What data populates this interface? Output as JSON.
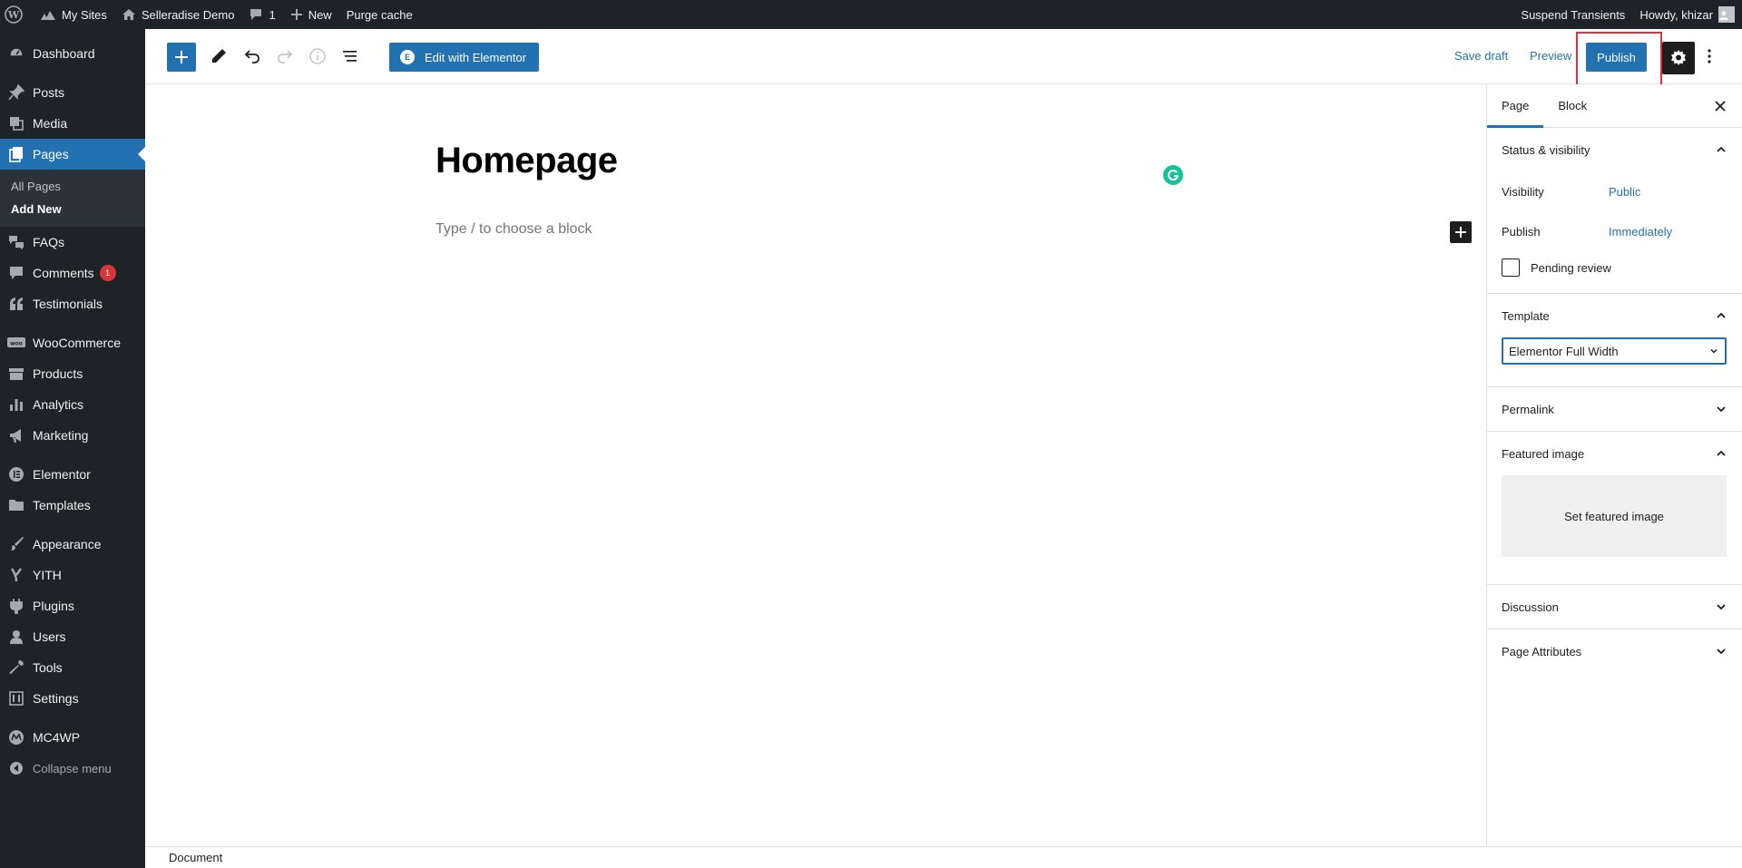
{
  "adminbar": {
    "my_sites": "My Sites",
    "site_name": "Selleradise Demo",
    "comments_count": "1",
    "new_label": "New",
    "purge_cache": "Purge cache",
    "suspend_transients": "Suspend Transients",
    "howdy": "Howdy, khizar"
  },
  "sidebar": {
    "items": [
      {
        "label": "Dashboard",
        "icon": "dashboard-icon"
      },
      {
        "label": "Posts",
        "icon": "pin-icon"
      },
      {
        "label": "Media",
        "icon": "media-icon"
      },
      {
        "label": "Pages",
        "icon": "pages-icon"
      },
      {
        "label": "FAQs",
        "icon": "faq-icon"
      },
      {
        "label": "Comments",
        "icon": "comment-icon",
        "badge": "1"
      },
      {
        "label": "Testimonials",
        "icon": "quote-icon"
      },
      {
        "label": "WooCommerce",
        "icon": "woo-icon"
      },
      {
        "label": "Products",
        "icon": "archive-icon"
      },
      {
        "label": "Analytics",
        "icon": "chart-icon"
      },
      {
        "label": "Marketing",
        "icon": "megaphone-icon"
      },
      {
        "label": "Elementor",
        "icon": "elementor-icon"
      },
      {
        "label": "Templates",
        "icon": "folder-icon"
      },
      {
        "label": "Appearance",
        "icon": "brush-icon"
      },
      {
        "label": "YITH",
        "icon": "yith-icon"
      },
      {
        "label": "Plugins",
        "icon": "plug-icon"
      },
      {
        "label": "Users",
        "icon": "user-icon"
      },
      {
        "label": "Tools",
        "icon": "wrench-icon"
      },
      {
        "label": "Settings",
        "icon": "settings-icon"
      },
      {
        "label": "MC4WP",
        "icon": "mc4wp-icon"
      }
    ],
    "submenu": [
      "All Pages",
      "Add New"
    ],
    "collapse": "Collapse menu"
  },
  "header": {
    "edit_elementor": "Edit with Elementor",
    "save_draft": "Save draft",
    "preview": "Preview",
    "publish": "Publish"
  },
  "editor": {
    "title": "Homepage",
    "placeholder": "Type / to choose a block"
  },
  "panel": {
    "tabs": [
      "Page",
      "Block"
    ],
    "status_visibility": "Status & visibility",
    "visibility_label": "Visibility",
    "visibility_value": "Public",
    "publish_label": "Publish",
    "publish_value": "Immediately",
    "pending_review": "Pending review",
    "template_label": "Template",
    "template_value": "Elementor Full Width",
    "permalink": "Permalink",
    "featured_image": "Featured image",
    "set_featured": "Set featured image",
    "discussion": "Discussion",
    "page_attributes": "Page Attributes"
  },
  "footer": {
    "breadcrumb": "Document"
  },
  "colors": {
    "admin_bg": "#1d2327",
    "accent": "#2271b1",
    "highlight_border": "#e0313a",
    "badge": "#d63638",
    "grammarly": "#15c39a"
  }
}
